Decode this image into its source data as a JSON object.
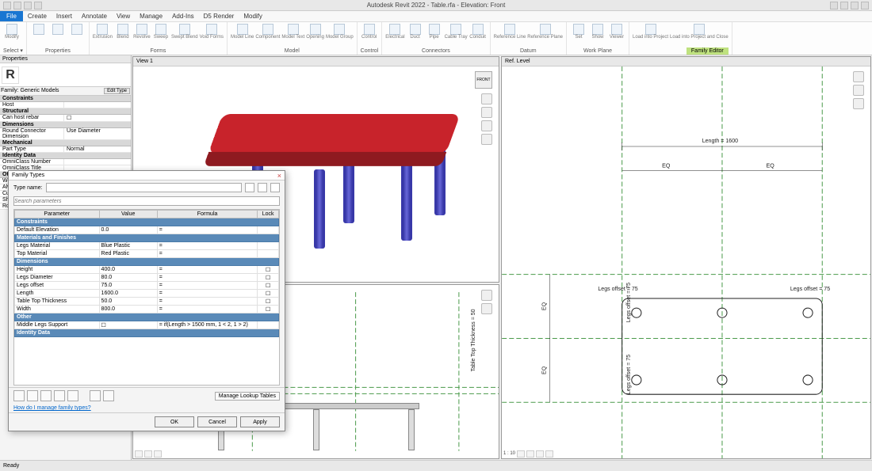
{
  "app": {
    "title": "Autodesk Revit 2022 - Table.rfa - Elevation: Front"
  },
  "menu": {
    "file": "File",
    "items": [
      "Create",
      "Insert",
      "Annotate",
      "View",
      "Manage",
      "Add-Ins",
      "D5 Render",
      "Modify"
    ]
  },
  "ribbon": {
    "groups": [
      {
        "label": "Select ▾",
        "items": [
          "Modify"
        ]
      },
      {
        "label": "Properties",
        "items": [
          "",
          "",
          ""
        ]
      },
      {
        "label": "Forms",
        "items": [
          "Extrusion",
          "Blend",
          "Revolve",
          "Sweep",
          "Swept Blend",
          "Void Forms"
        ]
      },
      {
        "label": "Model",
        "items": [
          "Model Line",
          "Component",
          "Model Text",
          "Opening",
          "Model Group"
        ]
      },
      {
        "label": "Control",
        "items": [
          "Control"
        ]
      },
      {
        "label": "Connectors",
        "items": [
          "Electrical",
          "Duct",
          "Pipe",
          "Cable Tray",
          "Conduit"
        ]
      },
      {
        "label": "Datum",
        "items": [
          "Reference Line",
          "Reference Plane"
        ]
      },
      {
        "label": "Work Plane",
        "items": [
          "Set",
          "Show",
          "Viewer"
        ]
      },
      {
        "label": "Family Editor",
        "items": [
          "Load into Project",
          "Load into Project and Close"
        ]
      }
    ]
  },
  "properties": {
    "header": "Properties",
    "family": "Family: Generic Models",
    "edit_type": "Edit Type",
    "sections": [
      {
        "name": "Constraints",
        "rows": [
          {
            "label": "Host",
            "value": ""
          }
        ]
      },
      {
        "name": "Structural",
        "rows": [
          {
            "label": "Can host rebar",
            "value": "☐"
          }
        ]
      },
      {
        "name": "Dimensions",
        "rows": [
          {
            "label": "Round Connector Dimension",
            "value": "Use Diameter"
          }
        ]
      },
      {
        "name": "Mechanical",
        "rows": [
          {
            "label": "Part Type",
            "value": "Normal"
          }
        ]
      },
      {
        "name": "Identity Data",
        "rows": [
          {
            "label": "OmniClass Number",
            "value": ""
          },
          {
            "label": "OmniClass Title",
            "value": ""
          }
        ]
      },
      {
        "name": "Other",
        "rows": [
          {
            "label": "Wo",
            "value": ""
          },
          {
            "label": "Alw",
            "value": ""
          },
          {
            "label": "Cut",
            "value": ""
          },
          {
            "label": "Sha",
            "value": ""
          },
          {
            "label": "Roo",
            "value": ""
          }
        ]
      }
    ]
  },
  "views": {
    "v1": "View 1",
    "v2": "Ref. Level",
    "cube": "FRONT"
  },
  "plan": {
    "length_label": "Length = 1600",
    "eq": "EQ",
    "legs_offset": "Legs offset = 75",
    "tabletop_thickness": "Table Top Thickness = 50",
    "scale": "1 : 10"
  },
  "dialog": {
    "title": "Family Types",
    "type_name_label": "Type name:",
    "search_placeholder": "Search parameters",
    "headers": {
      "param": "Parameter",
      "value": "Value",
      "formula": "Formula",
      "lock": "Lock"
    },
    "sections": [
      {
        "name": "Constraints",
        "rows": [
          {
            "p": "Default Elevation",
            "v": "0.0",
            "f": "=",
            "l": ""
          }
        ]
      },
      {
        "name": "Materials and Finishes",
        "rows": [
          {
            "p": "Legs Material",
            "v": "Blue Plastic",
            "f": "=",
            "l": ""
          },
          {
            "p": "Top Material",
            "v": "Red Plastic",
            "f": "=",
            "l": ""
          }
        ]
      },
      {
        "name": "Dimensions",
        "rows": [
          {
            "p": "Height",
            "v": "400.0",
            "f": "=",
            "l": "☐"
          },
          {
            "p": "Legs Diameter",
            "v": "80.0",
            "f": "=",
            "l": "☐"
          },
          {
            "p": "Legs offset",
            "v": "75.0",
            "f": "=",
            "l": "☐"
          },
          {
            "p": "Length",
            "v": "1600.0",
            "f": "=",
            "l": "☐"
          },
          {
            "p": "Table Top Thickness",
            "v": "50.0",
            "f": "=",
            "l": "☐"
          },
          {
            "p": "Width",
            "v": "800.0",
            "f": "=",
            "l": "☐"
          }
        ]
      },
      {
        "name": "Other",
        "rows": [
          {
            "p": "Middle Legs Support",
            "v": "☐",
            "f": "= if(Length > 1500 mm, 1 < 2, 1 > 2)",
            "l": ""
          }
        ]
      },
      {
        "name": "Identity Data",
        "rows": []
      }
    ],
    "lookup": "Manage Lookup Tables",
    "help": "How do I manage family types?",
    "buttons": {
      "ok": "OK",
      "cancel": "Cancel",
      "apply": "Apply"
    }
  },
  "status": {
    "ready": "Ready"
  }
}
